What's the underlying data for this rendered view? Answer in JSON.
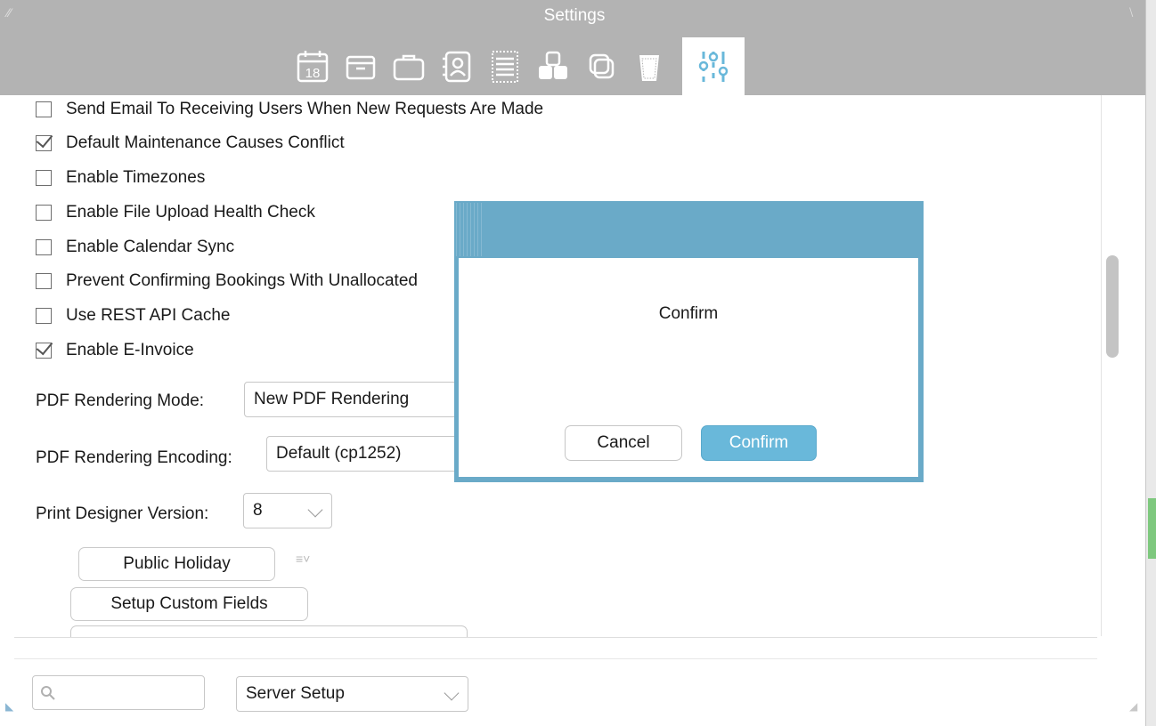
{
  "window": {
    "title": "Settings"
  },
  "toolbar": {
    "icons": [
      {
        "name": "calendar-icon",
        "text": "18"
      },
      {
        "name": "archive-box-icon"
      },
      {
        "name": "briefcase-icon"
      },
      {
        "name": "contact-card-icon"
      },
      {
        "name": "list-document-icon"
      },
      {
        "name": "shapes-icon"
      },
      {
        "name": "duplicate-icon"
      },
      {
        "name": "trash-icon"
      },
      {
        "name": "sliders-icon",
        "active": true
      }
    ],
    "accent": "#69b8da"
  },
  "settings": {
    "checkboxes": [
      {
        "label": "Send Email To Receiving Users When New Requests Are Made",
        "checked": false
      },
      {
        "label": "Default Maintenance Causes Conflict",
        "checked": true
      },
      {
        "label": "Enable Timezones",
        "checked": false
      },
      {
        "label": "Enable File Upload Health Check",
        "checked": false
      },
      {
        "label": "Enable Calendar Sync",
        "checked": false
      },
      {
        "label": "Prevent Confirming Bookings With Unallocated",
        "checked": false
      },
      {
        "label": "Use REST API Cache",
        "checked": false
      },
      {
        "label": "Enable E-Invoice",
        "checked": true
      }
    ],
    "pdf_mode": {
      "label": "PDF Rendering Mode:",
      "value": "New PDF Rendering"
    },
    "pdf_encoding": {
      "label": "PDF Rendering Encoding:",
      "value": "Default (cp1252)"
    },
    "print_designer": {
      "label": "Print Designer Version:",
      "value": "8"
    },
    "public_holiday_button": "Public Holiday",
    "custom_fields_button": "Setup Custom Fields"
  },
  "footer": {
    "search_value": "",
    "category_select": "Server Setup"
  },
  "dialog": {
    "message": "Confirm",
    "cancel_label": "Cancel",
    "confirm_label": "Confirm",
    "header_color": "#6aaac8"
  }
}
